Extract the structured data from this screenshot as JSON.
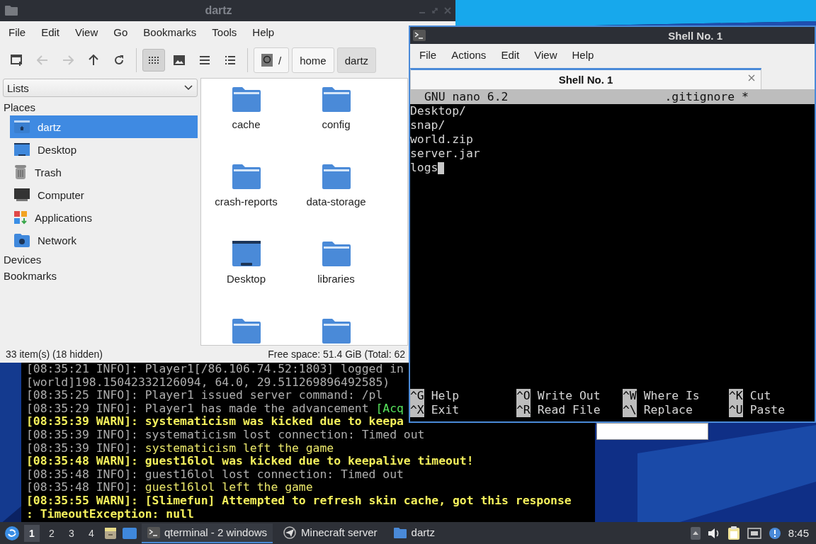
{
  "file_manager": {
    "title": "dartz",
    "menu": [
      "File",
      "Edit",
      "View",
      "Go",
      "Bookmarks",
      "Tools",
      "Help"
    ],
    "toolbar": [
      {
        "kind": "new-tab",
        "disabled": false,
        "selected": false
      },
      {
        "kind": "back",
        "disabled": true,
        "selected": false
      },
      {
        "kind": "forward",
        "disabled": true,
        "selected": false
      },
      {
        "kind": "up",
        "disabled": false,
        "selected": false
      },
      {
        "kind": "reload",
        "disabled": false,
        "selected": false
      },
      {
        "kind": "icons",
        "disabled": false,
        "selected": true
      },
      {
        "kind": "thumbnails",
        "disabled": false,
        "selected": false
      },
      {
        "kind": "compact",
        "disabled": false,
        "selected": false
      },
      {
        "kind": "details",
        "disabled": false,
        "selected": false
      }
    ],
    "path": [
      {
        "label": "/",
        "kind": "root",
        "selected": false
      },
      {
        "label": "home",
        "kind": "dir",
        "selected": false
      },
      {
        "label": "dartz",
        "kind": "dir",
        "selected": true
      }
    ],
    "side_pane": "Lists",
    "places_heading": "Places",
    "places": [
      {
        "label": "dartz",
        "kind": "home",
        "selected": true
      },
      {
        "label": "Desktop",
        "kind": "desktop",
        "selected": false
      },
      {
        "label": "Trash",
        "kind": "trash",
        "selected": false
      },
      {
        "label": "Computer",
        "kind": "computer",
        "selected": false
      },
      {
        "label": "Applications",
        "kind": "applications",
        "selected": false
      },
      {
        "label": "Network",
        "kind": "network",
        "selected": false
      }
    ],
    "sections": [
      "Devices",
      "Bookmarks"
    ],
    "files": [
      {
        "name": "cache",
        "kind": "folder"
      },
      {
        "name": "config",
        "kind": "folder"
      },
      {
        "name": "crash-reports",
        "kind": "folder"
      },
      {
        "name": "data-storage",
        "kind": "folder"
      },
      {
        "name": "Desktop",
        "kind": "desktop"
      },
      {
        "name": "libraries",
        "kind": "folder"
      },
      {
        "kind": "folder"
      },
      {
        "kind": "folder"
      }
    ],
    "status": {
      "items": "33 item(s) (18 hidden)",
      "free_space": "Free space: 51.4 GiB (Total: 62"
    }
  },
  "server_log": {
    "lines": [
      [
        {
          "text": "[08:35:21 INFO]: Player1[/86.106.74.52:1803] logged in",
          "kind": "info"
        }
      ],
      [
        {
          "text": "[world]198.15042332126094, 64.0, 29.511269896492585)",
          "kind": "info"
        }
      ],
      [
        {
          "text": "[08:35:25 INFO]: Player1 issued server command: /pl",
          "kind": "info"
        }
      ],
      [
        {
          "text": "[08:35:29 INFO]: Player1 has made the advancement ",
          "kind": "info"
        },
        {
          "text": "[Acq",
          "kind": "advancement"
        }
      ],
      [
        {
          "text": "[08:35:39 WARN]: systematicism was kicked due to keepa",
          "kind": "warn"
        }
      ],
      [
        {
          "text": "[08:35:39 INFO]: systematicism lost connection: Timed out",
          "kind": "info"
        }
      ],
      [
        {
          "text": "[08:35:39 INFO]: ",
          "kind": "info"
        },
        {
          "text": "systematicism left the game",
          "kind": "event"
        }
      ],
      [
        {
          "text": "[08:35:48 WARN]: guest16lol was kicked due to keepalive timeout!",
          "kind": "warn"
        }
      ],
      [
        {
          "text": "[08:35:48 INFO]: guest16lol lost connection: Timed out",
          "kind": "info"
        }
      ],
      [
        {
          "text": "[08:35:48 INFO]: ",
          "kind": "info"
        },
        {
          "text": "guest16lol left the game",
          "kind": "event"
        }
      ],
      [
        {
          "text": "[08:35:55 WARN]: [Slimefun] Attempted to refresh skin cache, got this response",
          "kind": "warn"
        }
      ],
      [
        {
          "text": ": TimeoutException: null",
          "kind": "warn"
        }
      ]
    ]
  },
  "terminal": {
    "title": "Shell No. 1",
    "menu": [
      "File",
      "Actions",
      "Edit",
      "View",
      "Help"
    ],
    "tabs": [
      {
        "label": "Shell No. 1",
        "selected": true
      }
    ],
    "nano": {
      "version": "GNU nano 6.2",
      "file": ".gitignore *",
      "lines": [
        "Desktop/",
        "snap/",
        "world.zip",
        "server.jar",
        "logs"
      ],
      "shortcuts": [
        {
          "key": "^G",
          "label": "Help"
        },
        {
          "key": "^O",
          "label": "Write Out"
        },
        {
          "key": "^W",
          "label": "Where Is"
        },
        {
          "key": "^K",
          "label": "Cut"
        },
        {
          "key": "^X",
          "label": "Exit"
        },
        {
          "key": "^R",
          "label": "Read File"
        },
        {
          "key": "^\\",
          "label": "Replace"
        },
        {
          "key": "^U",
          "label": "Paste"
        }
      ]
    }
  },
  "taskbar": {
    "workspaces": [
      {
        "label": "1",
        "selected": true
      },
      {
        "label": "2",
        "selected": false
      },
      {
        "label": "3",
        "selected": false
      },
      {
        "label": "4",
        "selected": false
      }
    ],
    "tasks": [
      {
        "label": "qterminal - 2 windows",
        "kind": "terminal",
        "selected": true
      },
      {
        "label": "Minecraft server",
        "kind": "app",
        "selected": false
      },
      {
        "label": "dartz",
        "kind": "folder",
        "selected": false
      }
    ],
    "clock": "8:45"
  }
}
